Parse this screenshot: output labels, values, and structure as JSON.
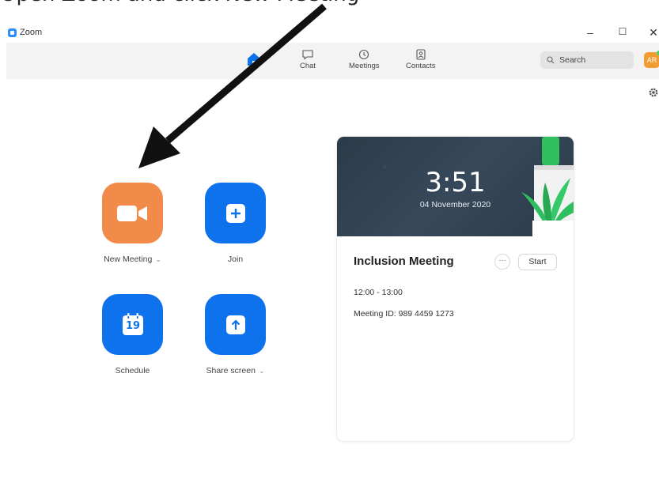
{
  "caption": "Open Zoom and click New Meeting",
  "window": {
    "title": "Zoom",
    "controls": {
      "minimize": "–",
      "maximize": "☐",
      "close": "✕"
    }
  },
  "nav": {
    "items": [
      {
        "label": "",
        "icon": "home-icon",
        "active": true
      },
      {
        "label": "Chat",
        "icon": "chat-icon"
      },
      {
        "label": "Meetings",
        "icon": "clock-icon"
      },
      {
        "label": "Contacts",
        "icon": "contacts-icon"
      }
    ],
    "search_placeholder": "Search",
    "avatar_initials": "AR"
  },
  "actions": {
    "new_meeting": "New Meeting",
    "join": "Join",
    "schedule": "Schedule",
    "schedule_day": "19",
    "share_screen": "Share screen",
    "dropdown_glyph": "⌄"
  },
  "meeting_card": {
    "time": "3:51",
    "date": "04 November 2020",
    "title": "Inclusion Meeting",
    "more": "···",
    "start": "Start",
    "time_range": "12:00 - 13:00",
    "meeting_id": "Meeting ID: 989 4459 1273"
  },
  "colors": {
    "brand_blue": "#0e72ed",
    "new_meeting_orange": "#f28a4a",
    "avatar_orange": "#f29d32",
    "banner_dark": "#2e3d4d"
  }
}
